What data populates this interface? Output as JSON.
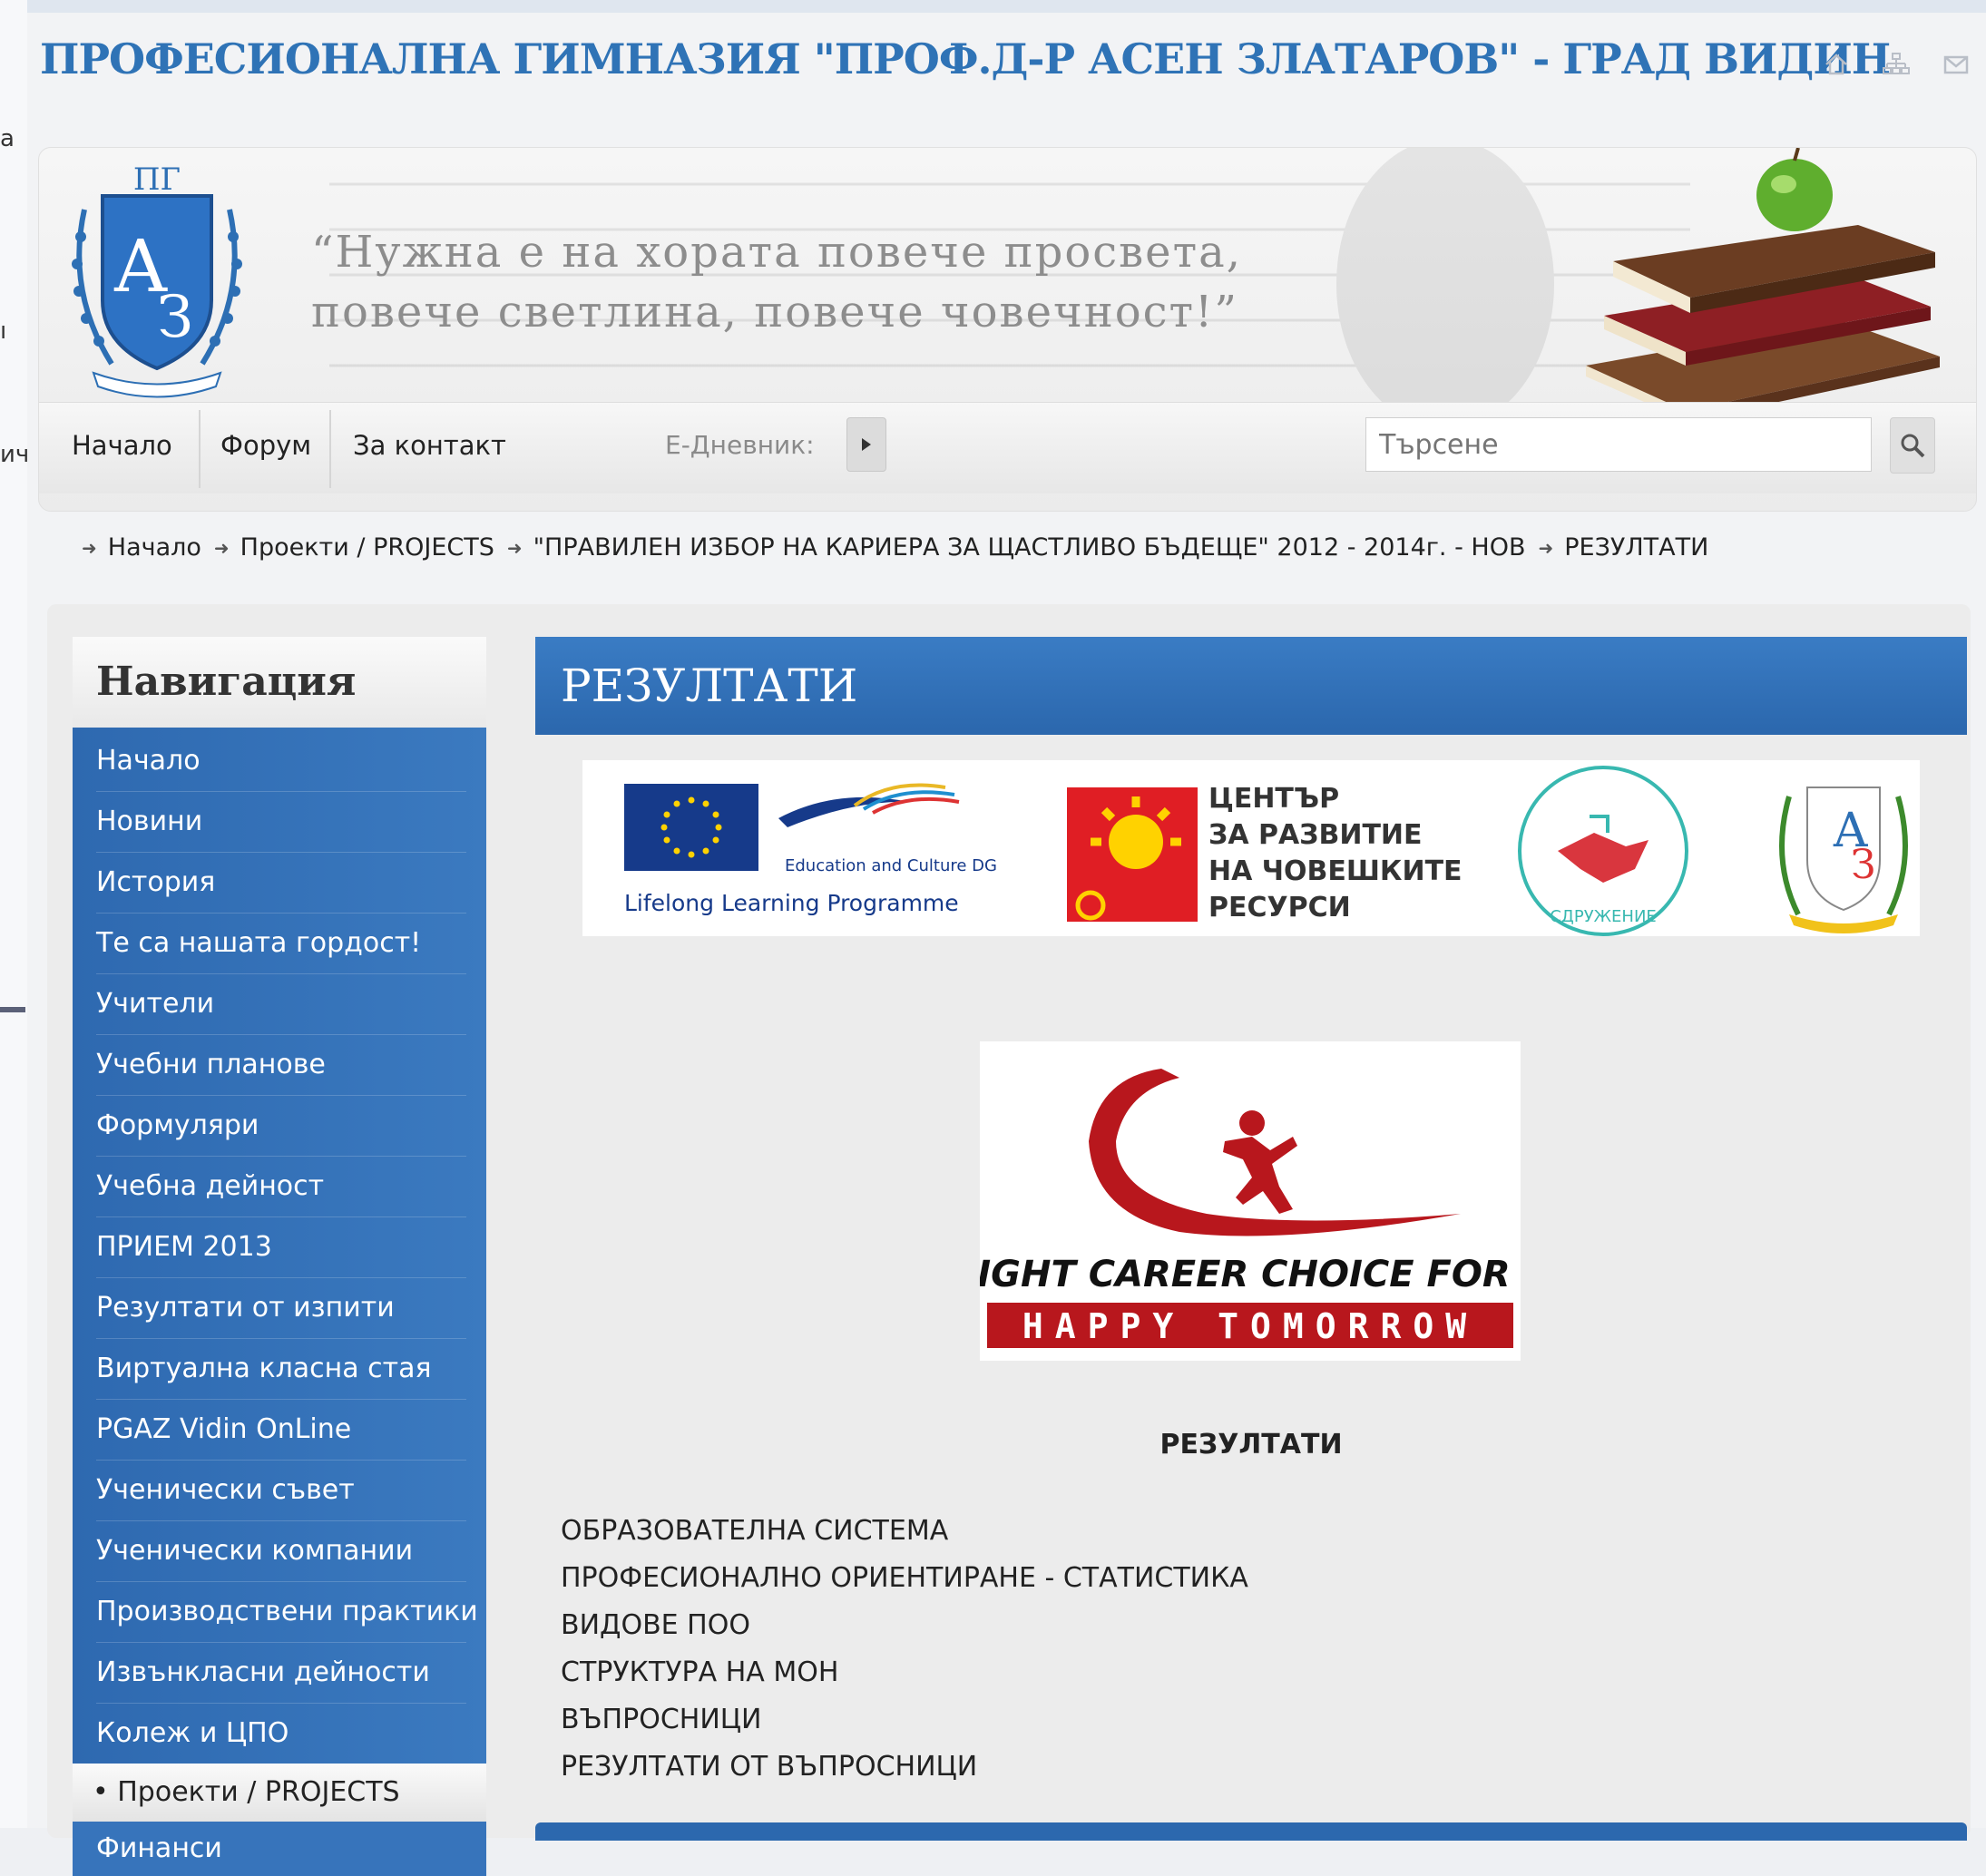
{
  "left_fragments": [
    "а",
    "ı",
    "ич"
  ],
  "site": {
    "title": "ПРОФЕСИОНАЛНА ГИМНАЗИЯ \"ПРОФ.Д-Р АСЕН ЗЛАТАРОВ\" - ГРАД ВИДИН",
    "icons": [
      "home-icon",
      "sitemap-icon",
      "mail-icon"
    ]
  },
  "banner": {
    "quote_line1": "“Нужна е на хората повече просвета,",
    "quote_line2": "повече светлина, повече човечност!”",
    "logo_text": "ПГ"
  },
  "navbar": {
    "items": [
      "Начало",
      "Форум",
      "За контакт"
    ],
    "ediary_label": "Е-Дневник:",
    "search_placeholder": "Търсене"
  },
  "breadcrumb": [
    "Начало",
    "Проекти / PROJECTS",
    "\"ПРАВИЛЕН ИЗБОР НА КАРИЕРА ЗА ЩАСТЛИВО БЪДЕЩЕ\" 2012 - 2014г. - НОВ",
    "РЕЗУЛТАТИ"
  ],
  "sidebar": {
    "title": "Навигация",
    "items": [
      "Начало",
      "Новини",
      "История",
      "Те са нашата гордост!",
      "Учители",
      "Учебни планове",
      "Формуляри",
      "Учебна дейност",
      "ПРИЕМ 2013",
      "Резултати от изпити",
      "Виртуална класна стая",
      "PGAZ Vidin OnLine",
      "Ученически съвет",
      "Ученически компании",
      "Производствени практики",
      "Извънкласни дейности",
      "Колеж и ЦПО"
    ],
    "active_item": "Проекти / PROJECTS",
    "next_item": "Финанси"
  },
  "main": {
    "title": "РЕЗУЛТАТИ",
    "logos": {
      "eu_top": "Education and Culture DG",
      "eu_bottom": "Lifelong Learning Programme",
      "center_line1": "ЦЕНТЪР",
      "center_line2": "ЗА РАЗВИТИЕ",
      "center_line3": "НА ЧОВЕШКИТЕ",
      "center_line4": "РЕСУРСИ",
      "assoc_text": "СДРУЖЕНИЕ"
    },
    "career": {
      "line1": "RIGHT CAREER CHOICE FOR A",
      "line2": "HAPPY TOMORROW"
    },
    "results_heading": "РЕЗУЛТАТИ",
    "results": [
      "ОБРАЗОВАТЕЛНА СИСТЕМА",
      "ПРОФЕСИОНАЛНО ОРИЕНТИРАНЕ - СТАТИСТИКА",
      "ВИДОВЕ ПОО",
      "СТРУКТУРА НА МОН",
      "ВЪПРОСНИЦИ",
      "РЕЗУЛТАТИ ОТ ВЪПРОСНИЦИ"
    ]
  },
  "colors": {
    "accent": "#2f73b6",
    "nav_blue": "#3774bb",
    "banner_red": "#b01e23"
  }
}
